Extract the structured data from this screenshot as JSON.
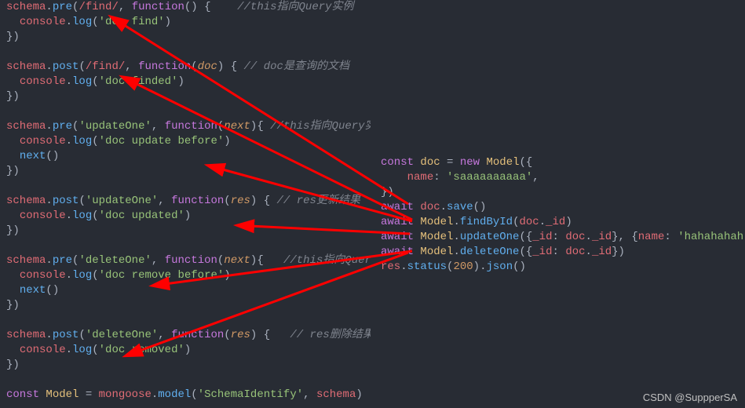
{
  "left": {
    "b1_l1_a": "schema",
    "b1_l1_b": "pre",
    "b1_l1_c": "/find/",
    "b1_l1_d": "function",
    "b1_l1_e": "//this指向Query实例",
    "b1_l2_a": "console",
    "b1_l2_b": "log",
    "b1_l2_c": "'doc find'",
    "b1_l3": "})",
    "b2_l1_a": "schema",
    "b2_l1_b": "post",
    "b2_l1_c": "/find/",
    "b2_l1_d": "function",
    "b2_l1_e": "doc",
    "b2_l1_f": "// doc是查询的文档",
    "b2_l2_a": "console",
    "b2_l2_b": "log",
    "b2_l2_c": "'doc finded'",
    "b2_l3": "})",
    "b3_l1_a": "schema",
    "b3_l1_b": "pre",
    "b3_l1_c": "'updateOne'",
    "b3_l1_d": "function",
    "b3_l1_e": "next",
    "b3_l1_f": "//this指向Query实例",
    "b3_l2_a": "console",
    "b3_l2_b": "log",
    "b3_l2_c": "'doc update before'",
    "b3_l3_a": "next",
    "b3_l4": "})",
    "b4_l1_a": "schema",
    "b4_l1_b": "post",
    "b4_l1_c": "'updateOne'",
    "b4_l1_d": "function",
    "b4_l1_e": "res",
    "b4_l1_f": "// res更新结果",
    "b4_l2_a": "console",
    "b4_l2_b": "log",
    "b4_l2_c": "'doc updated'",
    "b4_l3": "})",
    "b5_l1_a": "schema",
    "b5_l1_b": "pre",
    "b5_l1_c": "'deleteOne'",
    "b5_l1_d": "function",
    "b5_l1_e": "next",
    "b5_l1_f": "//this指向Query实例",
    "b5_l2_a": "console",
    "b5_l2_b": "log",
    "b5_l2_c": "'doc remove before'",
    "b5_l3_a": "next",
    "b5_l4": "})",
    "b6_l1_a": "schema",
    "b6_l1_b": "post",
    "b6_l1_c": "'deleteOne'",
    "b6_l1_d": "function",
    "b6_l1_e": "res",
    "b6_l1_f": "// res删除结果",
    "b6_l2_a": "console",
    "b6_l2_b": "log",
    "b6_l2_c": "'doc removed'",
    "b6_l3": "})",
    "b7_a": "const",
    "b7_b": "Model",
    "b7_c": "mongoose",
    "b7_d": "model",
    "b7_e": "'SchemaIdentify'",
    "b7_f": "schema"
  },
  "right": {
    "r1_a": "const",
    "r1_b": "doc",
    "r1_c": "new",
    "r1_d": "Model",
    "r2_a": "name",
    "r2_b": "'saaaaaaaaaa'",
    "r3": "})",
    "r4_a": "await",
    "r4_b": "doc",
    "r4_c": "save",
    "r5_a": "await",
    "r5_b": "Model",
    "r5_c": "findById",
    "r5_d": "doc",
    "r5_e": "_id",
    "r6_a": "await",
    "r6_b": "Model",
    "r6_c": "updateOne",
    "r6_d": "_id",
    "r6_e": "doc",
    "r6_f": "_id",
    "r6_g": "name",
    "r6_h": "'hahahahah'",
    "r7_a": "await",
    "r7_b": "Model",
    "r7_c": "deleteOne",
    "r7_d": "_id",
    "r7_e": "doc",
    "r7_f": "_id",
    "r8_a": "res",
    "r8_b": "status",
    "r8_c": "200",
    "r8_d": "json"
  },
  "watermark": "CSDN @SuppperSA"
}
